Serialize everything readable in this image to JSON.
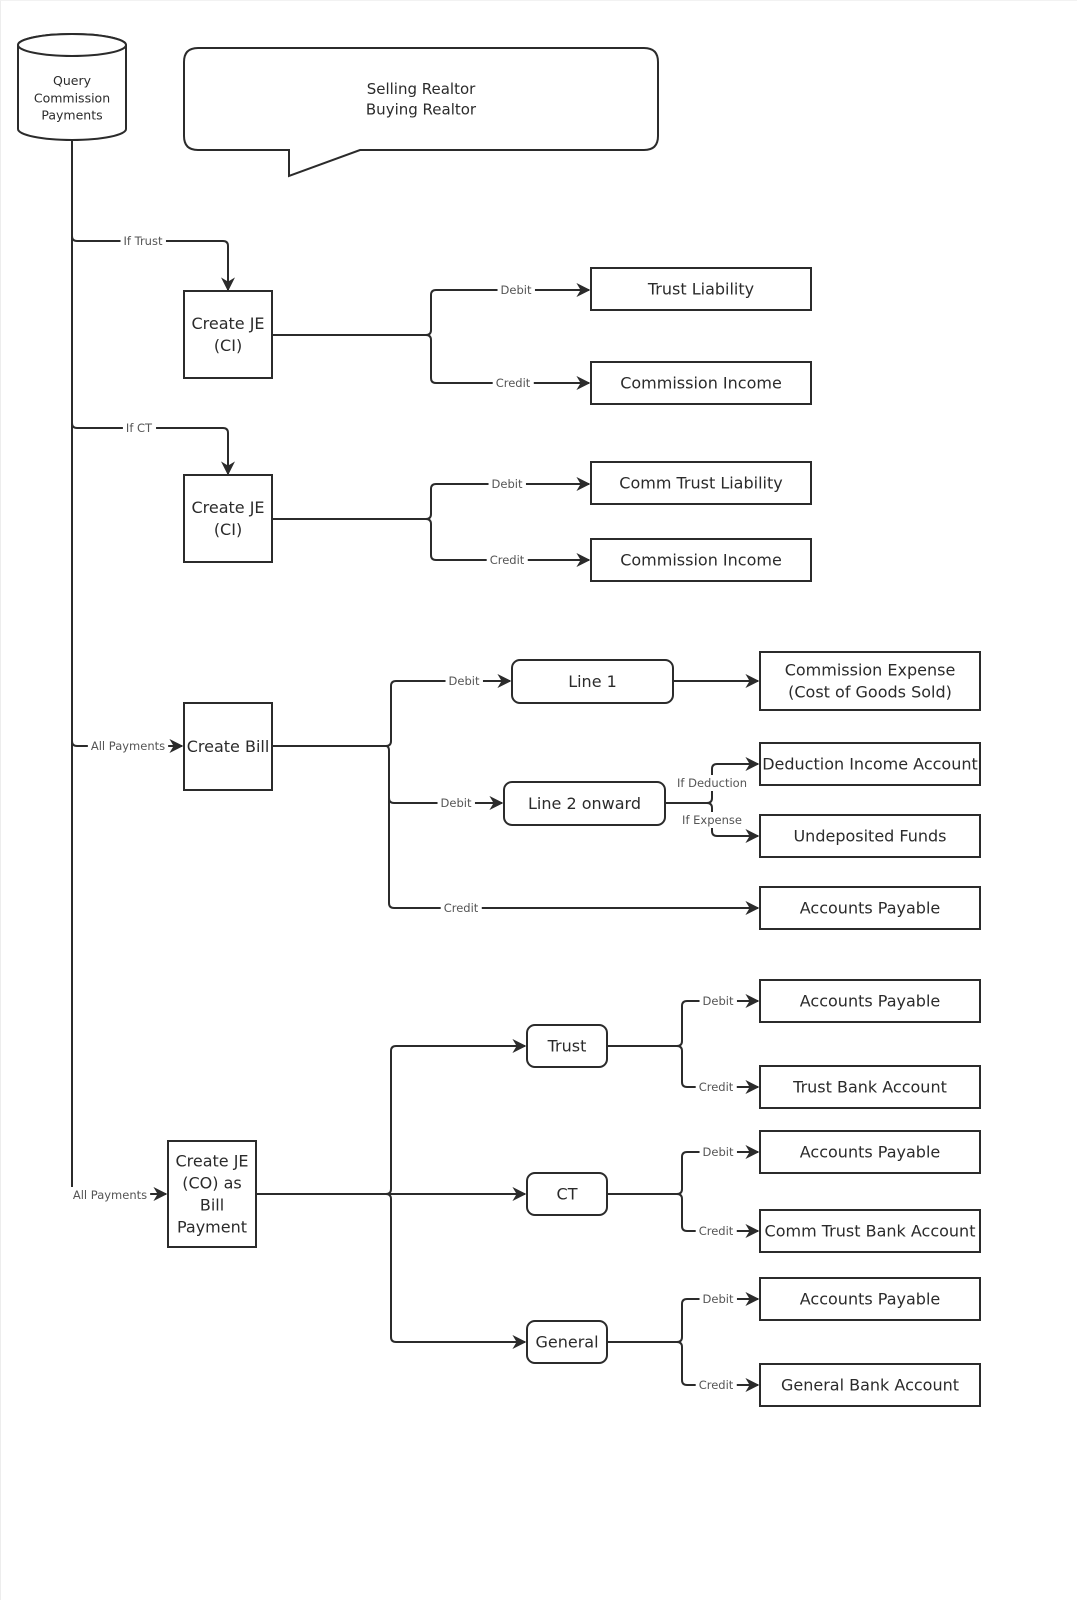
{
  "diagram": {
    "source": {
      "label_lines": [
        "Query",
        "Commission",
        "Payments"
      ]
    },
    "callout": {
      "label_lines": [
        "Selling Realtor",
        "Buying Realtor"
      ]
    },
    "colors": {
      "stroke": "#2b2b2b",
      "label": "#555555",
      "text": "#2b2b2b",
      "background": "#ffffff"
    },
    "branches": {
      "trust": {
        "condition": "If Trust",
        "process": {
          "label_lines": [
            "Create JE",
            "(CI)"
          ]
        },
        "entries": [
          {
            "type": "Debit",
            "account": "Trust Liability"
          },
          {
            "type": "Credit",
            "account": "Commission Income"
          }
        ]
      },
      "ct": {
        "condition": "If CT",
        "process": {
          "label_lines": [
            "Create JE",
            "(CI)"
          ]
        },
        "entries": [
          {
            "type": "Debit",
            "account": "Comm Trust Liability"
          },
          {
            "type": "Credit",
            "account": "Commission Income"
          }
        ]
      },
      "bill": {
        "condition": "All Payments",
        "process": {
          "label_lines": [
            "Create Bill"
          ]
        },
        "line1": {
          "type": "Debit",
          "label": "Line 1",
          "account_lines": [
            "Commission Expense",
            "(Cost of Goods Sold)"
          ]
        },
        "line2": {
          "type": "Debit",
          "label": "Line 2 onward",
          "options": [
            {
              "condition": "If Deduction",
              "account": "Deduction Income Account"
            },
            {
              "condition": "If Expense",
              "account": "Undeposited Funds"
            }
          ]
        },
        "credit": {
          "type": "Credit",
          "account": "Accounts Payable"
        }
      },
      "payment": {
        "condition": "All Payments",
        "process": {
          "label_lines": [
            "Create JE",
            "(CO) as",
            "Bill",
            "Payment"
          ]
        },
        "types": [
          {
            "label": "Trust",
            "entries": [
              {
                "type": "Debit",
                "account": "Accounts Payable"
              },
              {
                "type": "Credit",
                "account": "Trust Bank Account"
              }
            ]
          },
          {
            "label": "CT",
            "entries": [
              {
                "type": "Debit",
                "account": "Accounts Payable"
              },
              {
                "type": "Credit",
                "account": "Comm Trust Bank Account"
              }
            ]
          },
          {
            "label": "General",
            "entries": [
              {
                "type": "Debit",
                "account": "Accounts Payable"
              },
              {
                "type": "Credit",
                "account": "General Bank Account"
              }
            ]
          }
        ]
      }
    }
  }
}
